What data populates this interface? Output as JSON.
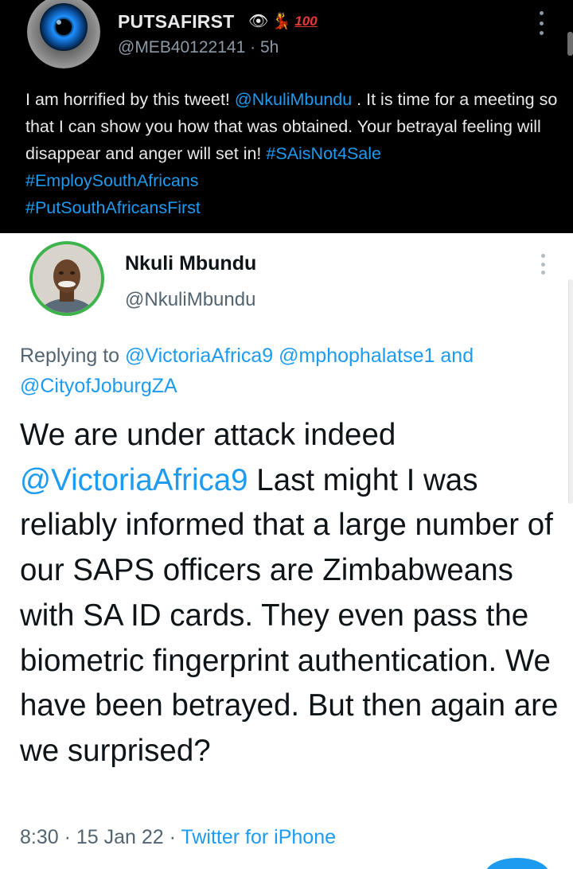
{
  "outer_tweet": {
    "display_name": "PUTSAFIRST",
    "emojis": {
      "eye": "👁",
      "dancer": "💃",
      "hundred": "100"
    },
    "handle": "@MEB40122141",
    "separator": "·",
    "time": "5h",
    "text": {
      "part1": "I am horrified by this tweet! ",
      "mention": "@NkuliMbundu",
      "part2": " . It is time for a meeting so that I can show you how that was obtained. Your betrayal feeling will disappear and anger will set in! ",
      "hashtag1": "#SAisNot4Sale",
      "hashtag2": "#EmploySouthAfricans",
      "hashtag3": "#PutSouthAfricansFirst"
    }
  },
  "quoted_tweet": {
    "display_name": "Nkuli Mbundu",
    "handle": "@NkuliMbundu",
    "replying": {
      "prefix": "Replying to ",
      "mention1": "@VictoriaAfrica9",
      "mention2": "@mphophalatse1",
      "and": " and ",
      "mention3": "@CityofJoburgZA"
    },
    "body": {
      "part1": "We are under attack indeed ",
      "mention": "@VictoriaAfrica9",
      "part2": " Last might I was reliably informed that a large number of our SAPS officers are Zimbabweans with SA ID cards. They even pass the biometric fingerprint authentication. We have been betrayed. But then again are we surprised?"
    },
    "meta": {
      "time": "8:30",
      "separator1": " · ",
      "date": "15 Jan 22",
      "separator2": " · ",
      "source": "Twitter for iPhone"
    }
  },
  "colors": {
    "link": "#1d9bf0",
    "dark_background": "#000000",
    "secondary_text": "#536471",
    "avatar_ring": "#3cb44b"
  },
  "icons": [
    "eye-avatar-image",
    "more-options-icon",
    "profile-photo"
  ]
}
